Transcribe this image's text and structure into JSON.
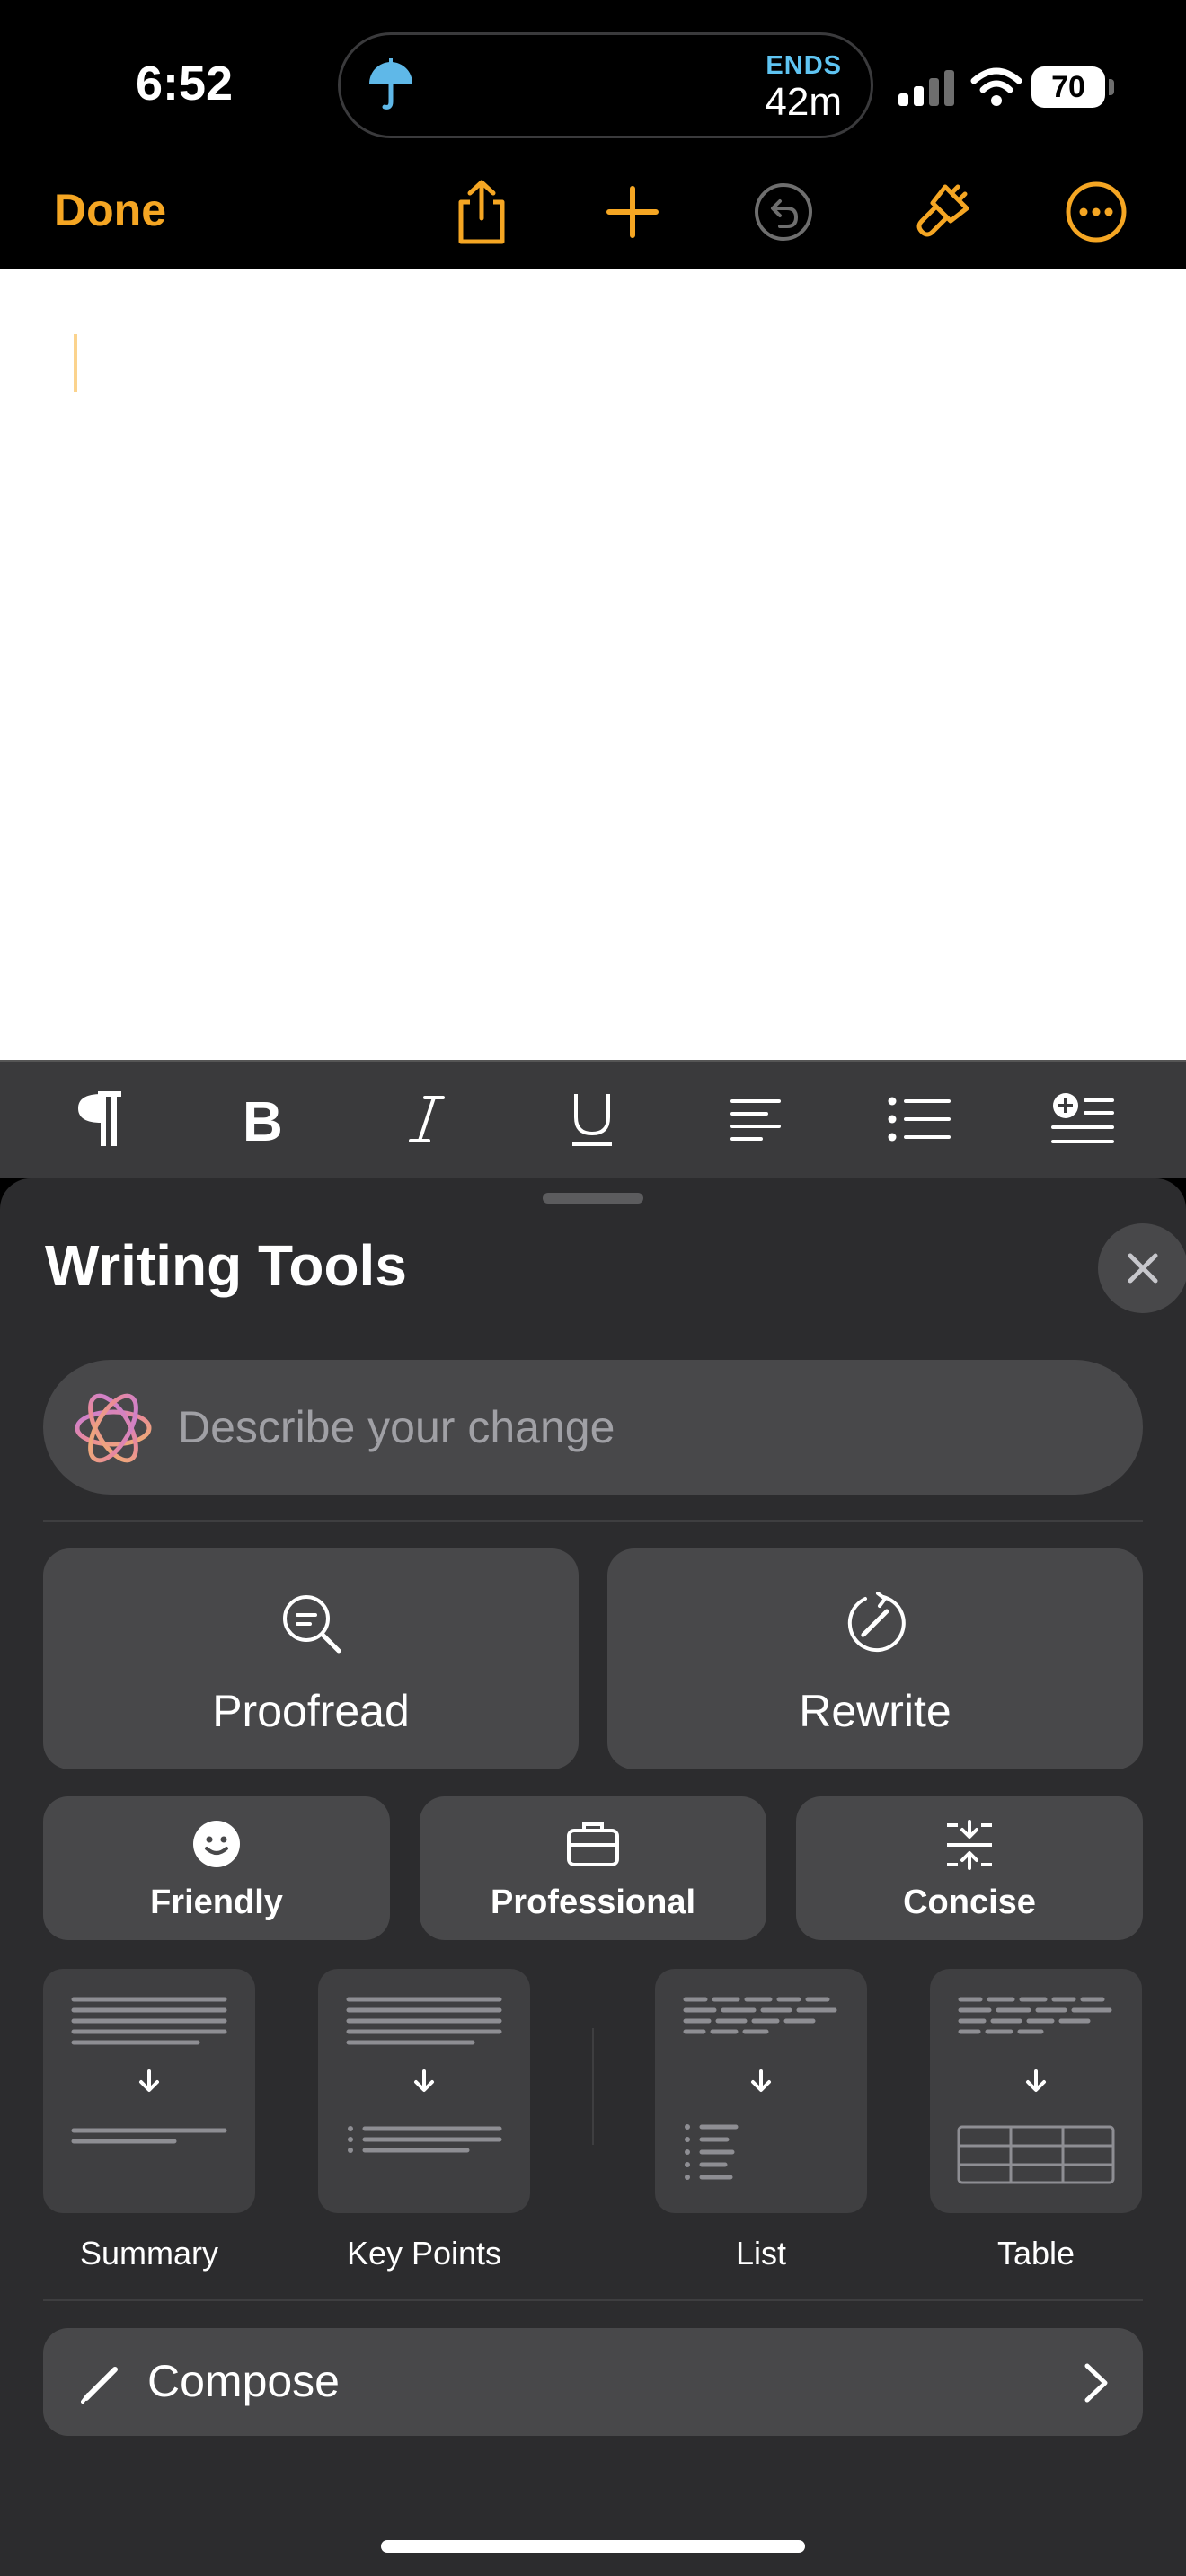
{
  "status_bar": {
    "time": "6:52",
    "live_activity": {
      "label": "ENDS",
      "value": "42m",
      "icon": "umbrella-icon"
    },
    "battery": "70"
  },
  "toolbar": {
    "done_label": "Done",
    "icons": [
      "share-icon",
      "plus-icon",
      "undo-icon",
      "paintbrush-icon",
      "more-icon"
    ]
  },
  "format_bar": {
    "icons": [
      "paragraph-icon",
      "bold-icon",
      "italic-icon",
      "underline-icon",
      "align-left-icon",
      "bullet-list-icon",
      "insert-icon"
    ]
  },
  "writing_tools": {
    "title": "Writing Tools",
    "describe_placeholder": "Describe your change",
    "primary": [
      {
        "label": "Proofread",
        "icon": "magnifier-icon"
      },
      {
        "label": "Rewrite",
        "icon": "rewrite-icon"
      }
    ],
    "tones": [
      {
        "label": "Friendly",
        "icon": "smiley-icon"
      },
      {
        "label": "Professional",
        "icon": "briefcase-icon"
      },
      {
        "label": "Concise",
        "icon": "compress-icon"
      }
    ],
    "formats": [
      {
        "label": "Summary",
        "icon": "summary-icon"
      },
      {
        "label": "Key Points",
        "icon": "key-points-icon"
      },
      {
        "label": "List",
        "icon": "list-icon"
      },
      {
        "label": "Table",
        "icon": "table-icon"
      }
    ],
    "compose_label": "Compose"
  },
  "colors": {
    "accent": "#f5a623",
    "panel": "#2c2c2e",
    "button": "#48484a"
  }
}
